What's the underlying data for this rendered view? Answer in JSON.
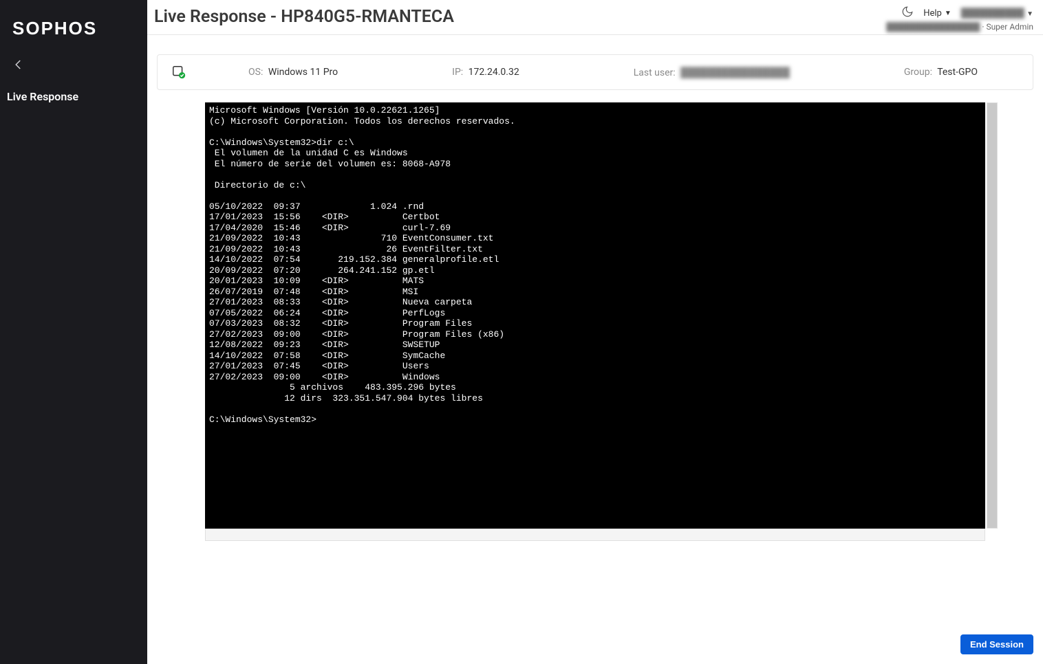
{
  "brand": "SOPHOS",
  "nav": {
    "live_response": "Live Response"
  },
  "header": {
    "title": "Live Response - HP840G5-RMANTECA",
    "help": "Help",
    "user_name": "██████████",
    "user_org": "████████████████",
    "role": "Super Admin"
  },
  "info": {
    "os_label": "OS:",
    "os_value": "Windows 11 Pro",
    "ip_label": "IP:",
    "ip_value": "172.24.0.32",
    "lastuser_label": "Last user:",
    "lastuser_value": "████████████████",
    "group_label": "Group:",
    "group_value": "Test-GPO"
  },
  "terminal": "Microsoft Windows [Versión 10.0.22621.1265]\n(c) Microsoft Corporation. Todos los derechos reservados.\n\nC:\\Windows\\System32>dir c:\\\n El volumen de la unidad C es Windows\n El número de serie del volumen es: 8068-A978\n\n Directorio de c:\\\n\n05/10/2022  09:37             1.024 .rnd\n17/01/2023  15:56    <DIR>          Certbot\n17/04/2020  15:46    <DIR>          curl-7.69\n21/09/2022  10:43               710 EventConsumer.txt\n21/09/2022  10:43                26 EventFilter.txt\n14/10/2022  07:54       219.152.384 generalprofile.etl\n20/09/2022  07:20       264.241.152 gp.etl\n20/01/2023  10:09    <DIR>          MATS\n26/07/2019  07:48    <DIR>          MSI\n27/01/2023  08:33    <DIR>          Nueva carpeta\n07/05/2022  06:24    <DIR>          PerfLogs\n07/03/2023  08:32    <DIR>          Program Files\n27/02/2023  09:00    <DIR>          Program Files (x86)\n12/08/2022  09:23    <DIR>          SWSETUP\n14/10/2022  07:58    <DIR>          SymCache\n27/01/2023  07:45    <DIR>          Users\n27/02/2023  09:00    <DIR>          Windows\n               5 archivos    483.395.296 bytes\n              12 dirs  323.351.547.904 bytes libres\n\nC:\\Windows\\System32>",
  "footer": {
    "end_session": "End Session"
  }
}
